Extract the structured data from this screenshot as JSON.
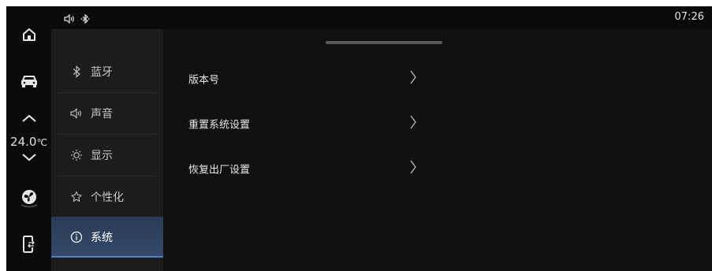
{
  "status": {
    "time": "07:26",
    "icons": [
      "volume-icon",
      "bluetooth-icon"
    ]
  },
  "dock": {
    "items": [
      "home-icon",
      "car-icon",
      "chevron-up-icon",
      "chevron-down-icon",
      "fan-icon",
      "phone-connect-icon"
    ],
    "temperature": "24.0",
    "temperature_unit": "℃"
  },
  "sidebar": {
    "items": [
      {
        "label": "蓝牙",
        "icon": "bluetooth-icon",
        "active": false
      },
      {
        "label": "声音",
        "icon": "volume-icon",
        "active": false
      },
      {
        "label": "显示",
        "icon": "brightness-icon",
        "active": false
      },
      {
        "label": "个性化",
        "icon": "personalize-icon",
        "active": false
      },
      {
        "label": "系统",
        "icon": "info-icon",
        "active": true
      }
    ]
  },
  "main": {
    "rows": [
      {
        "label": "版本号"
      },
      {
        "label": "重置系统设置"
      },
      {
        "label": "恢复出厂设置"
      }
    ]
  },
  "colors": {
    "accent": "#4f7fc9",
    "active_bg": "#2f4262",
    "sidebar_bg": "#1c1c1c",
    "content_bg": "#101010"
  }
}
